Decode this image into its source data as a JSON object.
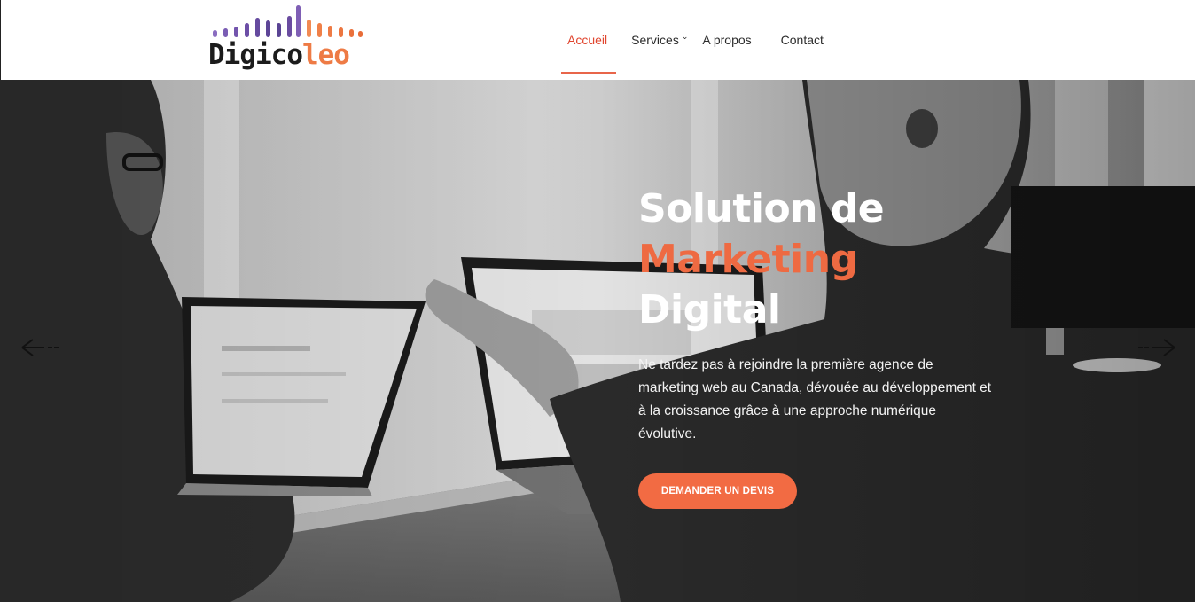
{
  "brand": {
    "name_part1": "Digico",
    "name_part2": "leo",
    "colors": {
      "purple": "#6e4fa3",
      "orange": "#ee7b45",
      "dark": "#1c1c1c"
    }
  },
  "nav": {
    "home": "Accueil",
    "services": "Services",
    "about": "A propos",
    "contact": "Contact",
    "active": "Accueil",
    "active_color": "#e0452e"
  },
  "hero": {
    "title_line1": "Solution de",
    "title_line2": "Marketing",
    "title_line3": "Digital",
    "description": "Ne tardez pas à rejoindre la première agence de marketing web au Canada, dévouée au développement et à la croissance grâce à une approche numérique évolutive.",
    "cta_label": "DEMANDER UN DEVIS",
    "accent_color": "#ee6a42",
    "prev_icon": "arrow-left-icon",
    "next_icon": "arrow-right-icon"
  }
}
